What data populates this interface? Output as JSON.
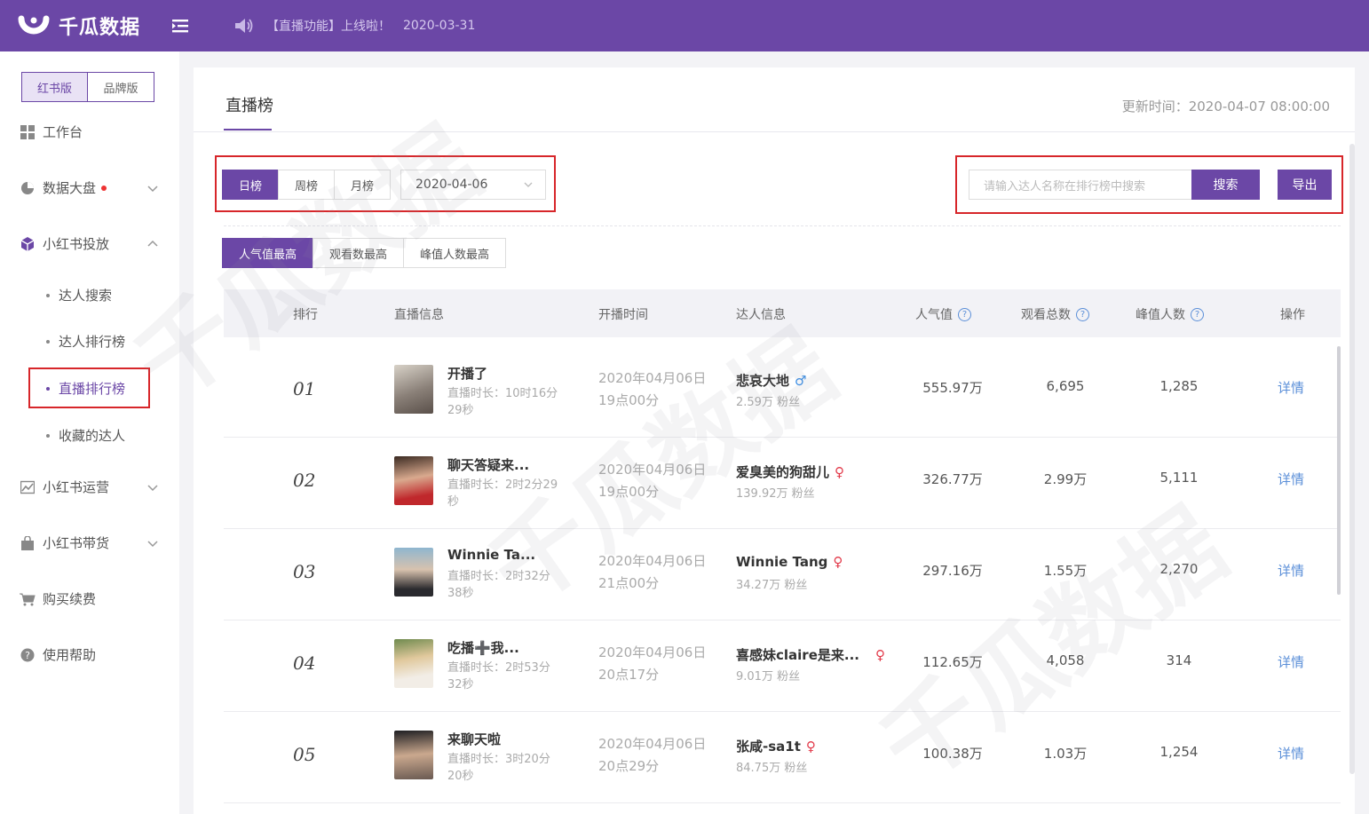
{
  "app": {
    "logo_text": "千瓜数据",
    "notice": "【直播功能】上线啦！",
    "notice_date": "2020-03-31",
    "brand_color": "#6b47a6",
    "highlight_color": "#d7262a"
  },
  "sidebar": {
    "versions": [
      "红书版",
      "品牌版"
    ],
    "items": [
      {
        "label": "工作台",
        "icon": "dashboard-grid-icon"
      },
      {
        "label": "数据大盘",
        "icon": "pie-chart-icon"
      },
      {
        "label": "小红书投放",
        "icon": "cube-icon"
      },
      {
        "label": "小红书运营",
        "icon": "image-chart-icon"
      },
      {
        "label": "小红书带货",
        "icon": "shopping-bag-icon"
      },
      {
        "label": "购买续费",
        "icon": "cart-icon"
      },
      {
        "label": "使用帮助",
        "icon": "help-bubble-icon"
      }
    ],
    "sub_items": [
      "达人搜索",
      "达人排行榜",
      "直播排行榜",
      "收藏的达人"
    ]
  },
  "page": {
    "title": "直播榜",
    "update_time": "更新时间：2020-04-07 08:00:00",
    "period_tabs": [
      "日榜",
      "周榜",
      "月榜"
    ],
    "date_value": "2020-04-06",
    "search_placeholder": "请输入达人名称在排行榜中搜索",
    "search_button": "搜索",
    "export_button": "导出",
    "sort_tabs": [
      "人气值最高",
      "观看数最高",
      "峰值人数最高"
    ]
  },
  "table": {
    "headers": {
      "rank": "排行",
      "live_info": "直播信息",
      "start_time": "开播时间",
      "talent_info": "达人信息",
      "popularity": "人气值",
      "total_views": "观看总数",
      "peak_viewers": "峰值人数",
      "action": "操作"
    },
    "rows": [
      {
        "rank": "01",
        "title": "开播了",
        "duration": "直播时长：10时16分29秒",
        "date": "2020年04月06日",
        "time": "19点00分",
        "talent": "悲哀大地",
        "sex": "♂",
        "sex_color": "#3a8ee6",
        "fans": "2.59万 粉丝",
        "popularity": "555.97万",
        "views": "6,695",
        "peak": "1,285",
        "action": "详情"
      },
      {
        "rank": "02",
        "title": "聊天答疑来...",
        "duration": "直播时长：2时2分29秒",
        "date": "2020年04月06日",
        "time": "19点00分",
        "talent": "爱臭美的狗甜儿",
        "sex": "♀",
        "sex_color": "#e23a4a",
        "fans": "139.92万 粉丝",
        "popularity": "326.77万",
        "views": "2.99万",
        "peak": "5,111",
        "action": "详情"
      },
      {
        "rank": "03",
        "title": "Winnie Ta...",
        "duration": "直播时长：2时32分38秒",
        "date": "2020年04月06日",
        "time": "21点00分",
        "talent": "Winnie Tang",
        "sex": "♀",
        "sex_color": "#e23a4a",
        "fans": "34.27万 粉丝",
        "popularity": "297.16万",
        "views": "1.55万",
        "peak": "2,270",
        "action": "详情"
      },
      {
        "rank": "04",
        "title": "吃播➕我...",
        "duration": "直播时长：2时53分32秒",
        "date": "2020年04月06日",
        "time": "20点17分",
        "talent": "喜感妹claire是来...",
        "sex": "♀",
        "sex_color": "#e23a4a",
        "fans": "9.01万 粉丝",
        "popularity": "112.65万",
        "views": "4,058",
        "peak": "314",
        "action": "详情"
      },
      {
        "rank": "05",
        "title": "来聊天啦",
        "duration": "直播时长：3时20分20秒",
        "date": "2020年04月06日",
        "time": "20点29分",
        "talent": "张咸-sa1t",
        "sex": "♀",
        "sex_color": "#e23a4a",
        "fans": "84.75万 粉丝",
        "popularity": "100.38万",
        "views": "1.03万",
        "peak": "1,254",
        "action": "详情"
      }
    ]
  }
}
